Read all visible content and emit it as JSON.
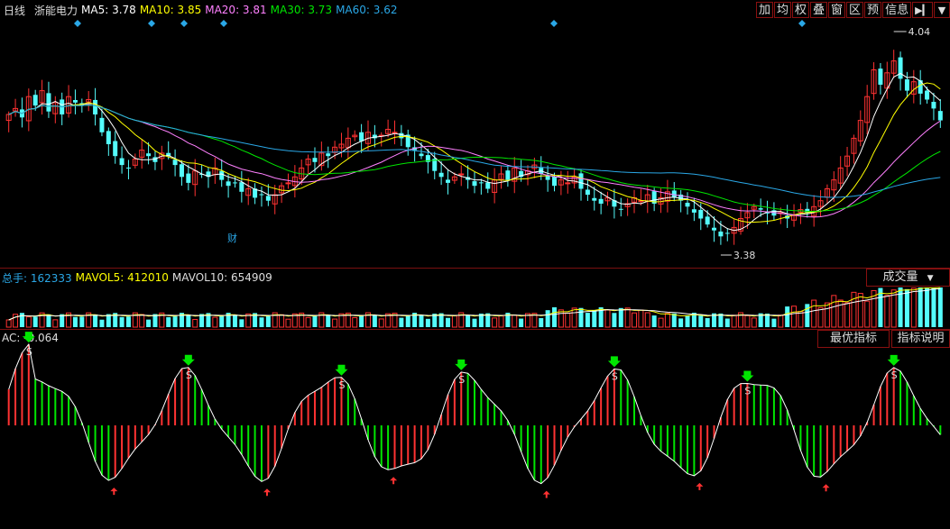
{
  "colors": {
    "up": "#ff3232",
    "down": "#54fcfc",
    "ma5": "#ffffff",
    "ma10": "#ffff00",
    "ma20": "#ff80ff",
    "ma30": "#00e600",
    "ma60": "#2aa7e6",
    "ac_pos": "#ff3232",
    "ac_neg": "#00e600",
    "grid": "#7a1010"
  },
  "header": {
    "period": "日线",
    "stock_name": "浙能电力",
    "ma5": "MA5: 3.78",
    "ma10": "MA10: 3.85",
    "ma20": "MA20: 3.81",
    "ma30": "MA30: 3.73",
    "ma60": "MA60: 3.62"
  },
  "toolbar": {
    "items": [
      "加",
      "均",
      "权",
      "叠",
      "窗",
      "区",
      "预",
      "信息"
    ],
    "arrow_icon": "arrow-right-icon",
    "menu_icon": "chevron-down-icon"
  },
  "price": {
    "high_label": "4.04",
    "low_label": "3.38",
    "event_label": "财",
    "ymin": 3.3,
    "ymax": 4.1,
    "closes": [
      3.8,
      3.82,
      3.79,
      3.86,
      3.83,
      3.88,
      3.81,
      3.84,
      3.8,
      3.86,
      3.84,
      3.83,
      3.85,
      3.8,
      3.74,
      3.7,
      3.66,
      3.63,
      3.62,
      3.65,
      3.68,
      3.66,
      3.64,
      3.67,
      3.66,
      3.63,
      3.59,
      3.57,
      3.61,
      3.6,
      3.59,
      3.62,
      3.58,
      3.56,
      3.57,
      3.54,
      3.55,
      3.52,
      3.53,
      3.51,
      3.53,
      3.56,
      3.57,
      3.59,
      3.62,
      3.65,
      3.64,
      3.67,
      3.66,
      3.69,
      3.7,
      3.72,
      3.73,
      3.71,
      3.74,
      3.72,
      3.73,
      3.75,
      3.74,
      3.72,
      3.69,
      3.68,
      3.66,
      3.64,
      3.61,
      3.59,
      3.57,
      3.59,
      3.6,
      3.58,
      3.56,
      3.57,
      3.55,
      3.58,
      3.6,
      3.58,
      3.62,
      3.59,
      3.61,
      3.63,
      3.6,
      3.58,
      3.56,
      3.58,
      3.57,
      3.59,
      3.55,
      3.53,
      3.51,
      3.5,
      3.52,
      3.49,
      3.48,
      3.5,
      3.52,
      3.51,
      3.53,
      3.5,
      3.52,
      3.54,
      3.52,
      3.51,
      3.49,
      3.47,
      3.45,
      3.43,
      3.41,
      3.39,
      3.4,
      3.42,
      3.45,
      3.47,
      3.49,
      3.48,
      3.47,
      3.46,
      3.47,
      3.45,
      3.46,
      3.48,
      3.47,
      3.49,
      3.51,
      3.55,
      3.58,
      3.62,
      3.66,
      3.72,
      3.78,
      3.86,
      3.95,
      3.9,
      3.94,
      3.98,
      3.92,
      3.88,
      3.91,
      3.87,
      3.85,
      3.82,
      3.78
    ]
  },
  "volume": {
    "label_total": "总手: 162333",
    "label_mavol5": "MAVOL5: 412010",
    "label_mavol10": "MAVOL10: 654909",
    "dropdown": "成交量"
  },
  "ac": {
    "label": "AC: -0.064",
    "btn_best": "最优指标",
    "btn_explain": "指标说明",
    "sell_mark": "S"
  }
}
